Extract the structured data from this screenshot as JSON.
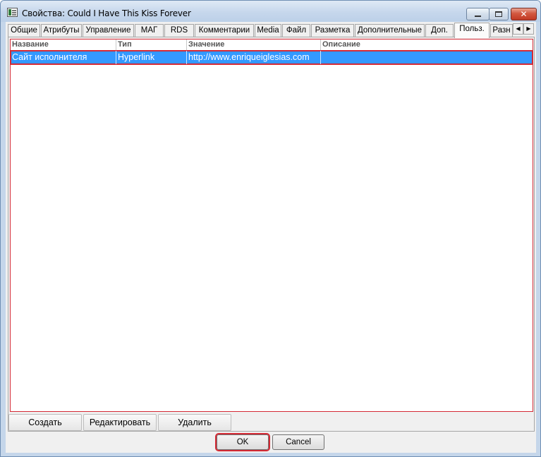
{
  "window": {
    "title": "Свойства: Could I Have This Kiss Forever",
    "close_glyph": "✕"
  },
  "tabs": [
    {
      "label": "Общие",
      "active": false
    },
    {
      "label": "Атрибуты",
      "active": false
    },
    {
      "label": "Управление",
      "active": false
    },
    {
      "label": "MAГ",
      "active": false
    },
    {
      "label": "RDS",
      "active": false
    },
    {
      "label": "Комментарии",
      "active": false
    },
    {
      "label": "Media",
      "active": false
    },
    {
      "label": "Файл",
      "active": false
    },
    {
      "label": "Разметка",
      "active": false
    },
    {
      "label": "Дополнительные",
      "active": false
    },
    {
      "label": "Доп.",
      "active": false
    },
    {
      "label": "Польз.",
      "active": true
    },
    {
      "label": "Разн",
      "active": false
    }
  ],
  "tab_scroll": {
    "left": "◀",
    "right": "▶"
  },
  "list": {
    "columns": [
      "Название",
      "Тип",
      "Значение",
      "Описание"
    ],
    "rows": [
      {
        "name": "Сайт исполнителя",
        "type": "Hyperlink",
        "value": "http://www.enriqueiglesias.com",
        "description": "",
        "selected": true
      }
    ]
  },
  "panel_buttons": {
    "create": "Создать",
    "edit": "Редактировать",
    "delete": "Удалить"
  },
  "dialog_buttons": {
    "ok": "OK",
    "cancel": "Cancel"
  },
  "colors": {
    "selection": "#3399ff",
    "highlight": "#d42a35",
    "window_frame": "#c5d6ea"
  }
}
